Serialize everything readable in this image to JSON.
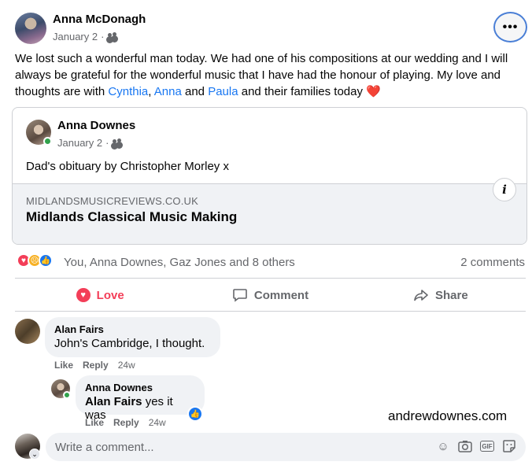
{
  "post": {
    "author": "Anna McDonagh",
    "date": "January 2",
    "more_label": "•••",
    "text_parts": {
      "intro": "We lost such a wonderful man today. We had one of his compositions at our wedding and I will always be grateful for the wonderful music that I have had the honour of playing. My love and thoughts are with ",
      "mention1": "Cynthia",
      "sep1": ", ",
      "mention2": "Anna",
      "sep2": " and ",
      "mention3": "Paula",
      "outro": " and their families today ",
      "emoji": "❤️"
    }
  },
  "shared": {
    "author": "Anna Downes",
    "date": "January 2",
    "text": "Dad's obituary by Christopher Morley x",
    "link_domain": "MIDLANDSMUSICREVIEWS.CO.UK",
    "link_title": "Midlands Classical Music Making",
    "info_label": "i"
  },
  "reactions": {
    "names": "You, Anna Downes, Gaz Jones and 8 others",
    "comment_count": "2 comments"
  },
  "actions": {
    "love": "Love",
    "comment": "Comment",
    "share": "Share"
  },
  "comments": [
    {
      "name": "Alan Fairs",
      "text": "John's Cambridge, I thought.",
      "like": "Like",
      "reply": "Reply",
      "time": "24w"
    },
    {
      "name": "Anna Downes",
      "mention": "Alan Fairs",
      "text": " yes it was",
      "like": "Like",
      "reply": "Reply",
      "time": "24w"
    }
  ],
  "watermark": "andrewdownes.com",
  "write_comment": {
    "placeholder": "Write a comment..."
  },
  "icons": {
    "emoji": "emoji-icon",
    "camera": "camera-icon",
    "gif": "GIF",
    "sticker": "sticker-icon"
  },
  "colors": {
    "accent": "#1877f2",
    "love": "#f33e58",
    "secondary_text": "#65676b"
  }
}
